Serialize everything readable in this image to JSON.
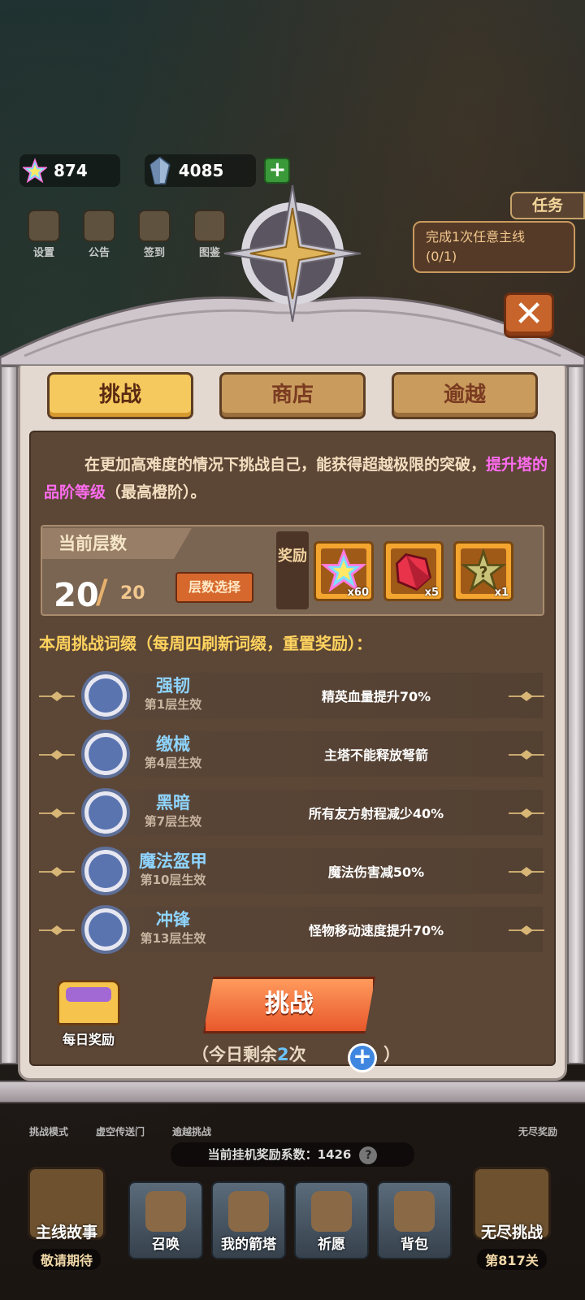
{
  "hud": {
    "star_value": "874",
    "gem_value": "4085"
  },
  "toolbar": {
    "items": [
      "设置",
      "公告",
      "签到",
      "图鉴"
    ]
  },
  "task": {
    "tag": "任务",
    "text": "完成1次任意主线",
    "progress": "(0/1)"
  },
  "tabs": [
    {
      "label": "挑战",
      "active": true
    },
    {
      "label": "商店",
      "active": false
    },
    {
      "label": "逾越",
      "active": false
    }
  ],
  "description": {
    "part1": "在更加高难度的情况下挑战自己，能获得超越极限的突破，",
    "highlight": "提升塔的品阶等级",
    "part2": "（最高橙阶）。"
  },
  "floor": {
    "header": "当前层数",
    "current": "20",
    "max": "20",
    "select_label": "层数选择",
    "reward_label": "奖励",
    "rewards": [
      {
        "icon": "rainbow-star-icon",
        "count": "x60"
      },
      {
        "icon": "red-crystal-icon",
        "count": "x5"
      },
      {
        "icon": "mystery-box-icon",
        "count": "x1"
      }
    ]
  },
  "weekly_title": "本周挑战词缀（每周四刷新词缀，重置奖励）：",
  "affixes": [
    {
      "name": "强韧",
      "floor": "第1层生效",
      "effect": "精英血量提升70%"
    },
    {
      "name": "缴械",
      "floor": "第4层生效",
      "effect": "主塔不能释放弩箭"
    },
    {
      "name": "黑暗",
      "floor": "第7层生效",
      "effect": "所有友方射程减少40%"
    },
    {
      "name": "魔法盔甲",
      "floor": "第10层生效",
      "effect": "魔法伤害减50%"
    },
    {
      "name": "冲锋",
      "floor": "第13层生效",
      "effect": "怪物移动速度提升70%"
    }
  ],
  "daily_reward": "每日奖励",
  "challenge_button": "挑战",
  "remaining": {
    "prefix": "（今日剩余",
    "count": "2",
    "suffix": "次"
  },
  "remaining_close": "）",
  "bottom": {
    "sub_labels": [
      "挑战模式",
      "虚空传送门",
      "逾越挑战",
      "无尽奖励"
    ],
    "coef_label": "当前挂机奖励系数：1426",
    "nav": [
      {
        "label": "主线故事",
        "sub": "敬请期待"
      },
      {
        "label": "召唤"
      },
      {
        "label": "我的箭塔"
      },
      {
        "label": "祈愿"
      },
      {
        "label": "背包"
      },
      {
        "label": "无尽挑战",
        "sub": "第817关"
      }
    ]
  }
}
